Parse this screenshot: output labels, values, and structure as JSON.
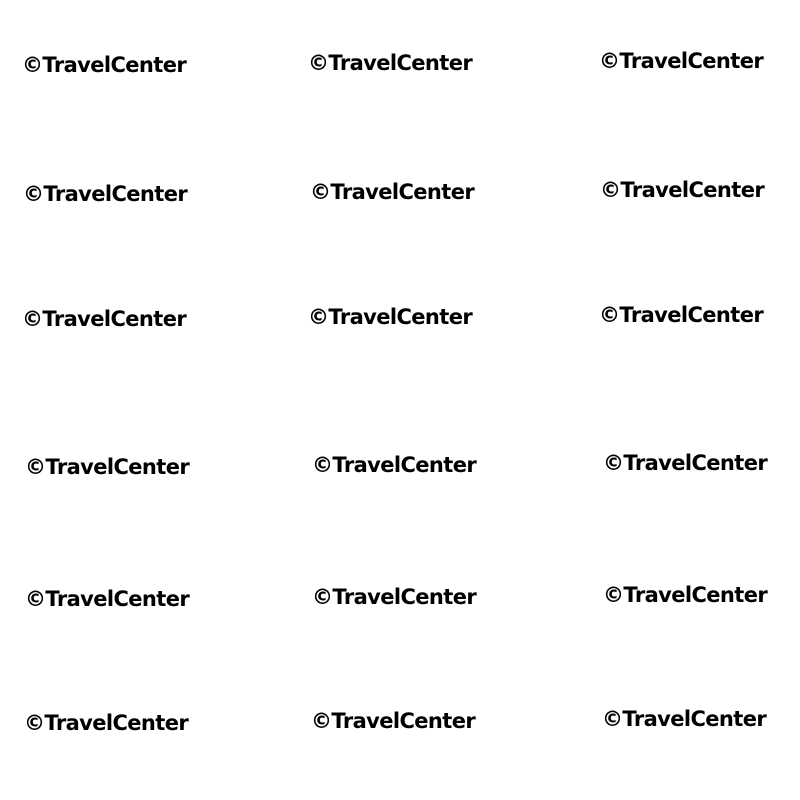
{
  "watermark": {
    "text": "©TravelCenter",
    "color": "#000000"
  },
  "page": {
    "background": "#ffffff"
  }
}
